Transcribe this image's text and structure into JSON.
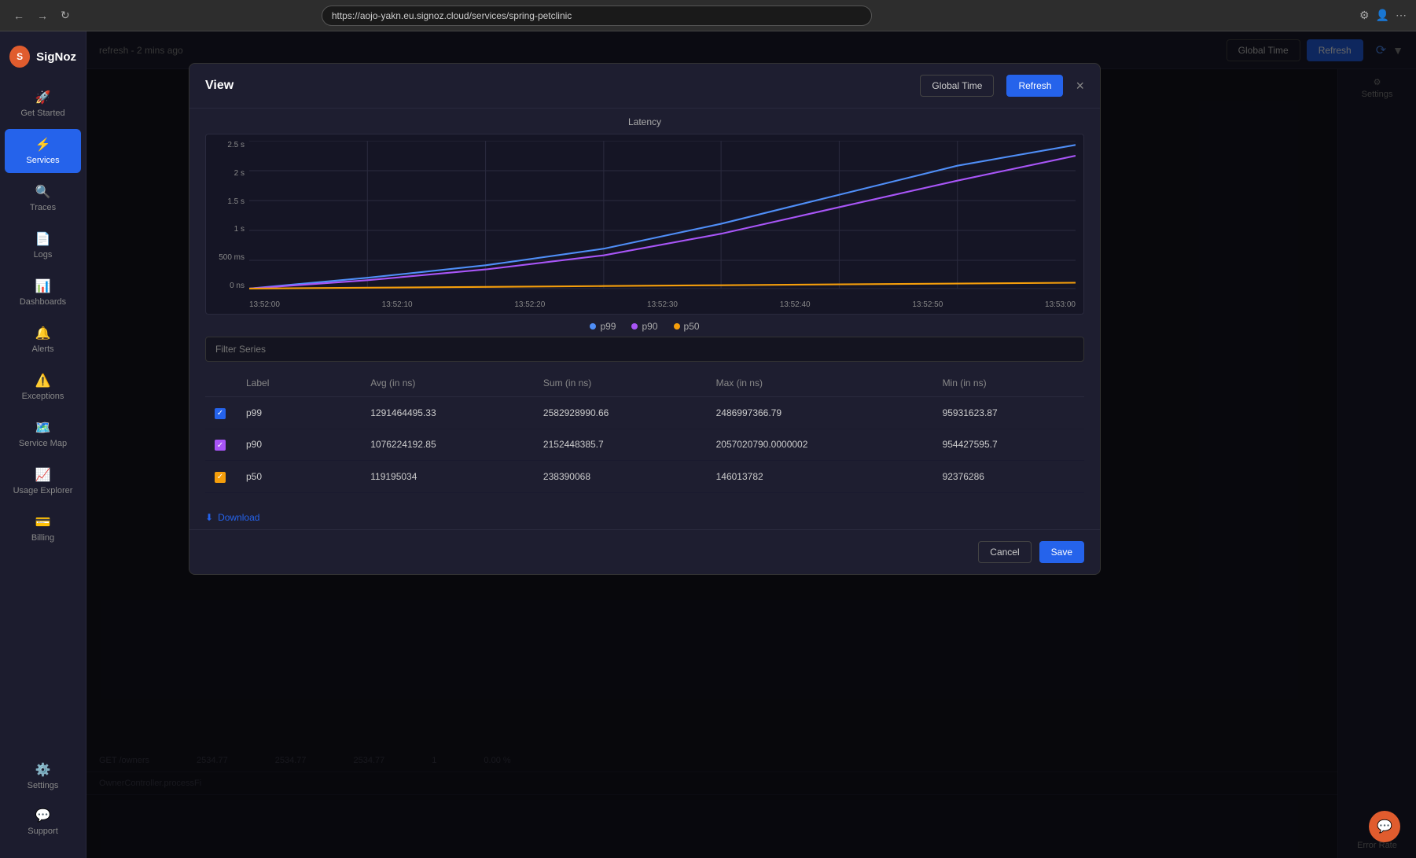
{
  "browser": {
    "url": "https://aojo-yakn.eu.signoz.cloud/services/spring-petclinic",
    "back": "←",
    "forward": "→",
    "reload": "↻"
  },
  "app": {
    "logo": {
      "icon": "S",
      "name": "SigNoz"
    }
  },
  "sidebar": {
    "items": [
      {
        "id": "get-started",
        "icon": "🚀",
        "label": "Get Started",
        "active": false
      },
      {
        "id": "services",
        "icon": "⚡",
        "label": "Services",
        "active": true
      },
      {
        "id": "traces",
        "icon": "🔍",
        "label": "Traces",
        "active": false
      },
      {
        "id": "logs",
        "icon": "📄",
        "label": "Logs",
        "active": false
      },
      {
        "id": "dashboards",
        "icon": "📊",
        "label": "Dashboards",
        "active": false
      },
      {
        "id": "alerts",
        "icon": "🔔",
        "label": "Alerts",
        "active": false
      },
      {
        "id": "exceptions",
        "icon": "⚠️",
        "label": "Exceptions",
        "active": false
      },
      {
        "id": "service-map",
        "icon": "🗺️",
        "label": "Service Map",
        "active": false
      },
      {
        "id": "usage-explorer",
        "icon": "📈",
        "label": "Usage Explorer",
        "active": false
      },
      {
        "id": "billing",
        "icon": "💳",
        "label": "Billing",
        "active": false
      }
    ],
    "bottom_items": [
      {
        "id": "settings",
        "icon": "⚙️",
        "label": "Settings",
        "active": false
      },
      {
        "id": "support",
        "icon": "💬",
        "label": "Support",
        "active": false
      }
    ]
  },
  "topbar": {
    "global_time_label": "Global Time",
    "refresh_label": "Refresh",
    "refresh_time": "refresh - 2 mins ago"
  },
  "modal": {
    "title": "View",
    "close_icon": "×",
    "chart_title": "Latency",
    "filter_placeholder": "Filter Series",
    "table": {
      "headers": [
        "",
        "Label",
        "",
        "Avg (in ns)",
        "Sum (in ns)",
        "Max (in ns)",
        "Min (in ns)"
      ],
      "rows": [
        {
          "checkbox_color": "blue",
          "label": "p99",
          "avg": "1291464495.33",
          "sum": "2582928990.66",
          "max": "2486997366.79",
          "min": "95931623.87"
        },
        {
          "checkbox_color": "purple",
          "label": "p90",
          "avg": "1076224192.85",
          "sum": "2152448385.7",
          "max": "2057020790.0000002",
          "min": "954427595.7"
        },
        {
          "checkbox_color": "orange",
          "label": "p50",
          "avg": "119195034",
          "sum": "238390068",
          "max": "146013782",
          "min": "92376286"
        }
      ]
    },
    "legend": [
      {
        "label": "p99",
        "color": "#4f8ef7"
      },
      {
        "label": "p90",
        "color": "#a855f7"
      },
      {
        "label": "p50",
        "color": "#f59e0b"
      }
    ],
    "chart": {
      "y_labels": [
        "2.5 s",
        "2 s",
        "1.5 s",
        "1 s",
        "500 ms",
        "0 ns"
      ],
      "x_labels": [
        "13:52:00",
        "13:52:10",
        "13:52:20",
        "13:52:30",
        "13:52:40",
        "13:52:50",
        "13:53:00"
      ]
    },
    "footer": {
      "cancel_label": "Cancel",
      "save_label": "Save"
    },
    "download_label": "Download"
  },
  "settings_panel": {
    "settings_label": "Settings"
  },
  "bg_table": {
    "rows": [
      {
        "name": "GET /owners",
        "col1": "2534.77",
        "col2": "2534.77",
        "col3": "2534.77",
        "col4": "1",
        "col5": "0.00 %"
      },
      {
        "name": "OwnerController.processFi",
        "col1": "",
        "col2": "",
        "col3": "",
        "col4": "",
        "col5": ""
      }
    ]
  },
  "error_rate_label": "Error Rate"
}
